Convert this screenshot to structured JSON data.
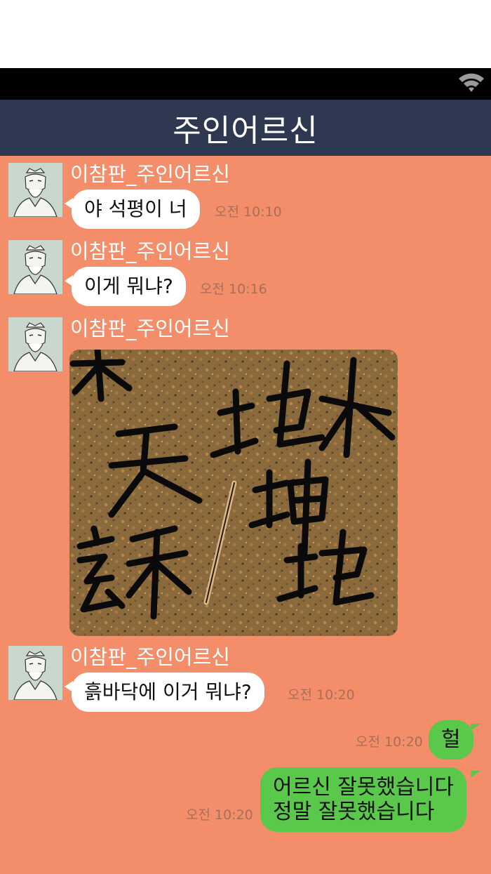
{
  "header": {
    "title": "주인어르신"
  },
  "status_bar": {
    "wifi_icon": "wifi-icon"
  },
  "messages": [
    {
      "sender": "이참판_주인어르신",
      "text": "야 석평이 너",
      "time": "오전 10:10"
    },
    {
      "sender": "이참판_주인어르신",
      "text": "이게 뭐냐?",
      "time": "오전 10:16"
    },
    {
      "sender": "이참판_주인어르신",
      "image": "dirt-ground-with-chinese-characters"
    },
    {
      "sender": "이참판_주인어르신",
      "text": "흙바닥에 이거 뭐냐?",
      "time": "오전 10:20"
    },
    {
      "outgoing": true,
      "text": "헐",
      "time": "오전 10:20"
    },
    {
      "outgoing": true,
      "lines": [
        "어르신 잘못했습니다",
        "정말 잘못했습니다"
      ],
      "time": "오전 10:20"
    }
  ],
  "colors": {
    "chat_background": "#f48d69",
    "title_bar": "#2e3850",
    "incoming_bubble": "#ffffff",
    "outgoing_bubble": "#5ac84a"
  }
}
